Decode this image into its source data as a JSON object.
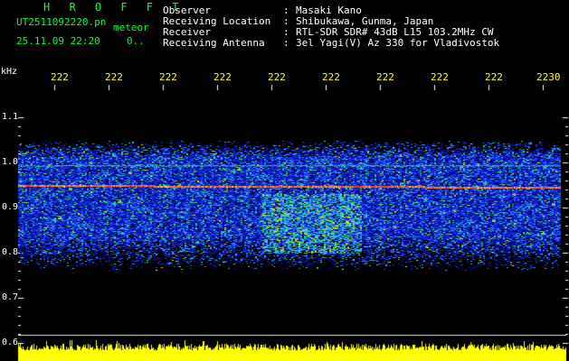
{
  "header": {
    "app_title": "H R O F F T",
    "file_name": "UT2511092220.pn",
    "meteor_label": "meteor",
    "timestamp": "25.11.09 22:20",
    "count": "0..",
    "info": [
      {
        "label": "Observer",
        "value": "Masaki Kano"
      },
      {
        "label": "Receiving Location",
        "value": "Shibukawa, Gunma, Japan"
      },
      {
        "label": "Receiver",
        "value": "RTL-SDR SDR# 43dB L15 103.2MHz CW"
      },
      {
        "label": "Receiving Antenna",
        "value": "3el Yagi(V) Az 330 for Vladivostok"
      }
    ]
  },
  "axis": {
    "freq_unit": "kHz",
    "freq_ticks": [
      "1.1",
      "1.0",
      "0.9",
      "0.8",
      "0.7",
      "0.6"
    ],
    "time_ticks": [
      "222",
      "222",
      "222",
      "222",
      "222",
      "222",
      "222",
      "222",
      "222",
      "2230"
    ]
  },
  "colors": {
    "background": "#000000",
    "text": "#ffffff",
    "title": "#00ff40",
    "time_axis": "#ffff00",
    "noise_bar": "#ffff00"
  }
}
